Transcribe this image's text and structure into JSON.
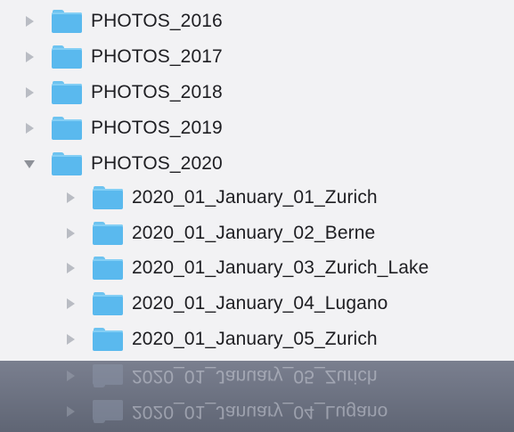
{
  "tree": {
    "top_folders": [
      {
        "label": "PHOTOS_2016",
        "expanded": false
      },
      {
        "label": "PHOTOS_2017",
        "expanded": false
      },
      {
        "label": "PHOTOS_2018",
        "expanded": false
      },
      {
        "label": "PHOTOS_2019",
        "expanded": false
      },
      {
        "label": "PHOTOS_2020",
        "expanded": true
      }
    ],
    "sub_folders": [
      {
        "label": "2020_01_January_01_Zurich"
      },
      {
        "label": "2020_01_January_02_Berne"
      },
      {
        "label": "2020_01_January_03_Zurich_Lake"
      },
      {
        "label": "2020_01_January_04_Lugano"
      },
      {
        "label": "2020_01_January_05_Zurich"
      }
    ]
  },
  "reflection": {
    "items": [
      {
        "label": "2020_01_January_05_Zurich"
      },
      {
        "label": "2020_01_January_04_Lugano"
      }
    ]
  },
  "colors": {
    "folder": "#5ab9ee",
    "panel_bg": "#f2f2f4",
    "page_bg": "#0e1524"
  }
}
